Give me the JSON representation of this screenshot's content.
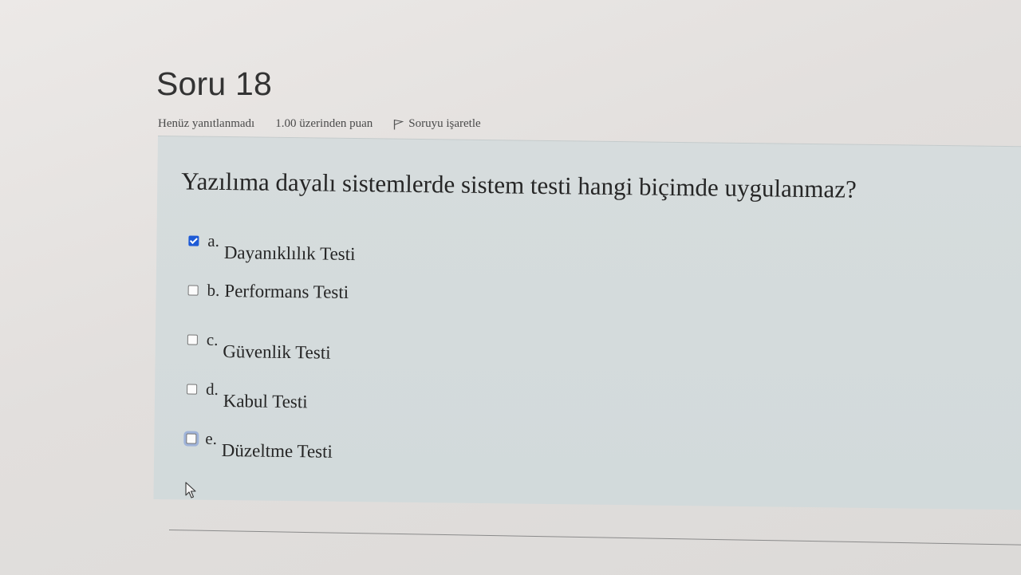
{
  "question": {
    "title": "Soru 18",
    "status": "Henüz yanıtlanmadı",
    "grade": "1.00 üzerinden puan",
    "flag_label": "Soruyu işaretle",
    "text": "Yazılıma dayalı sistemlerde sistem testi hangi biçimde uygulanmaz?",
    "options": [
      {
        "letter": "a.",
        "text": "Dayanıklılık Testi",
        "checked": true
      },
      {
        "letter": "b.",
        "text": "Performans Testi",
        "checked": false
      },
      {
        "letter": "c.",
        "text": "Güvenlik Testi",
        "checked": false
      },
      {
        "letter": "d.",
        "text": "Kabul Testi",
        "checked": false
      },
      {
        "letter": "e.",
        "text": "Düzeltme Testi",
        "checked": false
      }
    ]
  },
  "icons": {
    "flag": "flag-icon",
    "cursor": "mouse-pointer-icon",
    "checkbox_checked_color": "#1e5bd6"
  }
}
